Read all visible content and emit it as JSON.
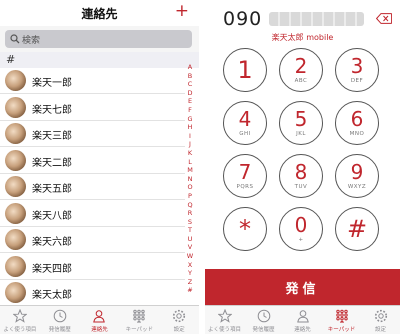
{
  "contacts_screen": {
    "title": "連絡先",
    "add_symbol": "+",
    "search_placeholder": "検索",
    "section_label": "#",
    "contacts": [
      {
        "name": "楽天一郎"
      },
      {
        "name": "楽天七郎"
      },
      {
        "name": "楽天三郎"
      },
      {
        "name": "楽天二郎"
      },
      {
        "name": "楽天五郎"
      },
      {
        "name": "楽天八郎"
      },
      {
        "name": "楽天六郎"
      },
      {
        "name": "楽天四郎"
      },
      {
        "name": "楽天太郎"
      }
    ],
    "index_letters": [
      "A",
      "B",
      "C",
      "D",
      "E",
      "F",
      "G",
      "H",
      "I",
      "J",
      "K",
      "L",
      "M",
      "N",
      "O",
      "P",
      "Q",
      "R",
      "S",
      "T",
      "U",
      "V",
      "W",
      "X",
      "Y",
      "Z",
      "#"
    ]
  },
  "keypad_screen": {
    "number_prefix": "090",
    "caller_name": "楽天太郎",
    "caller_label": "mobile",
    "keys": [
      {
        "digit": "1",
        "letters": ""
      },
      {
        "digit": "2",
        "letters": "ABC"
      },
      {
        "digit": "3",
        "letters": "DEF"
      },
      {
        "digit": "4",
        "letters": "GHI"
      },
      {
        "digit": "5",
        "letters": "JKL"
      },
      {
        "digit": "6",
        "letters": "MNO"
      },
      {
        "digit": "7",
        "letters": "PQRS"
      },
      {
        "digit": "8",
        "letters": "TUV"
      },
      {
        "digit": "9",
        "letters": "WXYZ"
      },
      {
        "digit": "*",
        "letters": ""
      },
      {
        "digit": "0",
        "letters": "+"
      },
      {
        "digit": "#",
        "letters": ""
      }
    ],
    "call_label": "発信"
  },
  "tabbar": {
    "tabs": [
      {
        "label": "よく使う項目",
        "icon": "star-icon"
      },
      {
        "label": "発信履歴",
        "icon": "clock-icon"
      },
      {
        "label": "連絡先",
        "icon": "person-icon"
      },
      {
        "label": "キーパッド",
        "icon": "keypad-icon"
      },
      {
        "label": "設定",
        "icon": "gear-icon"
      }
    ],
    "left_active_index": 2,
    "right_active_index": 3
  },
  "colors": {
    "accent": "#c0262d",
    "search_fill": "#c9c9ce",
    "section_header": "#efeff4"
  }
}
